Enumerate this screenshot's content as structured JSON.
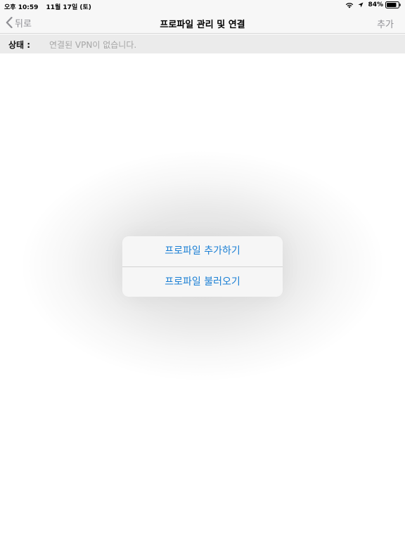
{
  "status_bar": {
    "time": "오후 10:59",
    "date": "11월 17일 (토)",
    "battery": "84%",
    "icons": [
      "wifi-icon",
      "location-arrow-icon",
      "battery-icon"
    ]
  },
  "nav": {
    "back_label": "뒤로",
    "title": "프로파일 관리 및 연결",
    "add_label": "추가"
  },
  "status_row": {
    "label": "상태 :",
    "value": "연결된 VPN이 없습니다."
  },
  "action_sheet": {
    "items": [
      {
        "label": "프로파일 추가하기"
      },
      {
        "label": "프로파일 불러오기"
      }
    ]
  },
  "colors": {
    "accent": "#1a7fd4",
    "nav_inactive": "#8e8e93",
    "status_row_bg": "#ebebeb"
  }
}
